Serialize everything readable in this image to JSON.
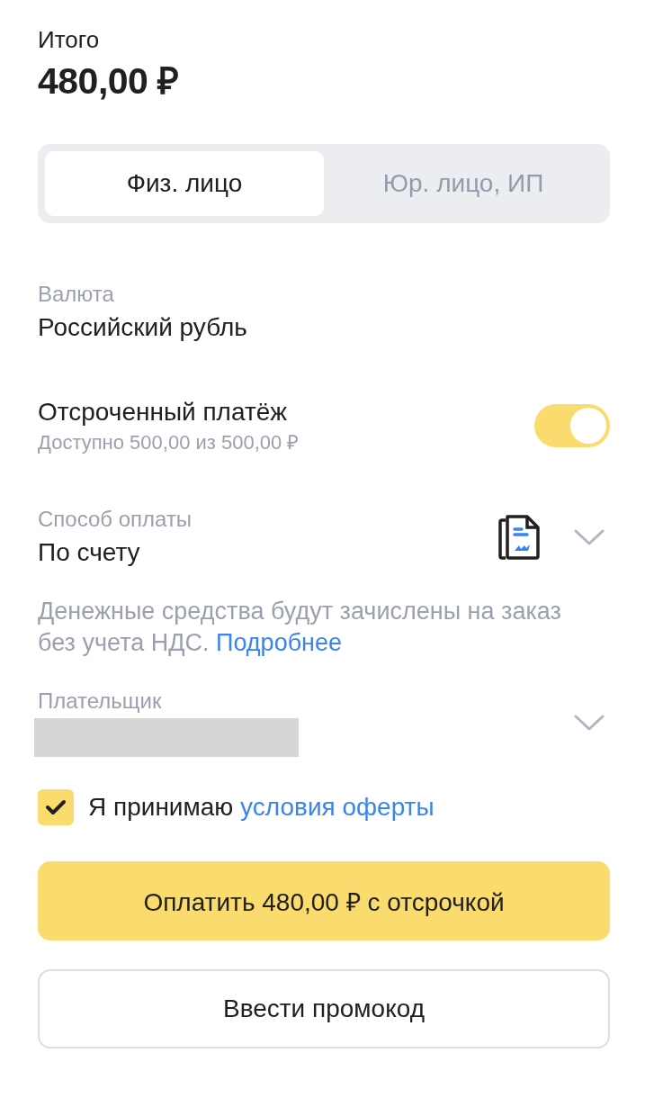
{
  "total": {
    "label": "Итого",
    "amount": "480,00 ₽"
  },
  "payer_type_tabs": [
    {
      "label": "Физ. лицо",
      "selected": true
    },
    {
      "label": "Юр. лицо, ИП",
      "selected": false
    }
  ],
  "currency": {
    "label": "Валюта",
    "value": "Российский рубль"
  },
  "deferred_payment": {
    "label": "Отсроченный платёж",
    "hint": "Доступно 500,00 из 500,00 ₽",
    "on": true
  },
  "payment_method": {
    "label": "Способ оплаты",
    "value": "По счету"
  },
  "info": {
    "text": "Денежные средства будут зачислены на заказ без учета НДС.",
    "link": "Подробнее"
  },
  "payer": {
    "label": "Плательщик"
  },
  "agreement": {
    "text": "Я принимаю",
    "link": "условия оферты",
    "checked": true
  },
  "buttons": [
    {
      "kind": "primary",
      "label": "Оплатить 480,00 ₽ с отсрочкой"
    },
    {
      "kind": "secondary",
      "label": "Ввести промокод"
    }
  ]
}
